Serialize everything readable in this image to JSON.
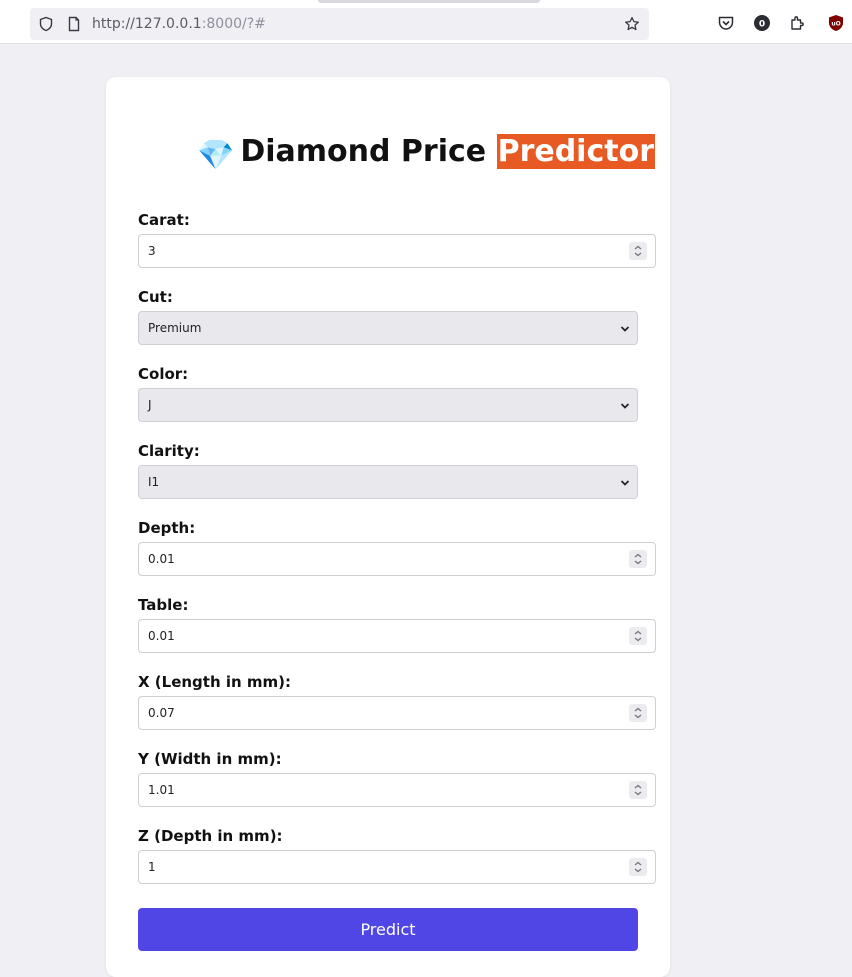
{
  "browser": {
    "url_host": "http://127.0.0.1",
    "url_rest": ":8000/?#",
    "icons": [
      "shield-icon",
      "page-icon",
      "star-icon",
      "pocket-icon",
      "account-icon",
      "extensions-icon",
      "ublock-icon"
    ]
  },
  "page": {
    "title_emoji": "💎",
    "title_main": "Diamond Price ",
    "title_highlight": "Predictor",
    "accent_color": "#e85a24",
    "button_color": "#4f46e5"
  },
  "form": {
    "carat": {
      "label": "Carat:",
      "value": "3"
    },
    "cut": {
      "label": "Cut:",
      "value": "Premium"
    },
    "color": {
      "label": "Color:",
      "value": "J"
    },
    "clarity": {
      "label": "Clarity:",
      "value": "I1"
    },
    "depth": {
      "label": "Depth:",
      "value": "0.01"
    },
    "table": {
      "label": "Table:",
      "value": "0.01"
    },
    "x": {
      "label": "X (Length in mm):",
      "value": "0.07"
    },
    "y": {
      "label": "Y (Width in mm):",
      "value": "1.01"
    },
    "z": {
      "label": "Z (Depth in mm):",
      "value": "1"
    },
    "submit_label": "Predict"
  }
}
